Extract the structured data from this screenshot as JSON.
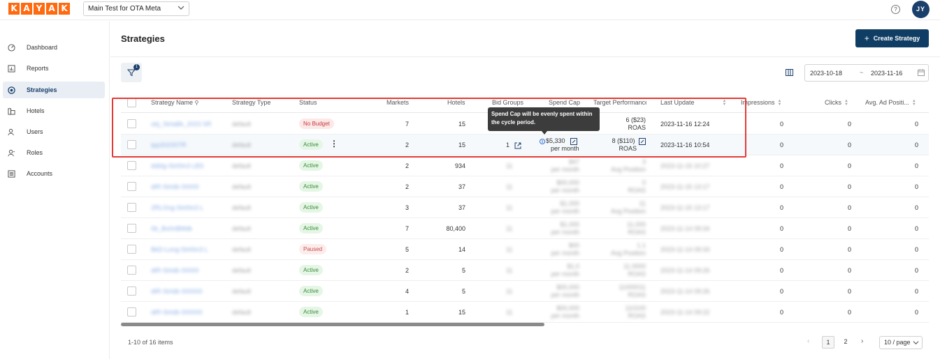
{
  "brand": {
    "letters": [
      "K",
      "A",
      "Y",
      "A",
      "K"
    ],
    "color": "#ff690f"
  },
  "topbar": {
    "account": "Main Test for OTA Meta",
    "help": "?",
    "avatar": "JY"
  },
  "sidebar": {
    "items": [
      {
        "label": "Dashboard",
        "icon": "dashboard-icon"
      },
      {
        "label": "Reports",
        "icon": "reports-icon"
      },
      {
        "label": "Strategies",
        "icon": "strategies-icon",
        "active": true
      },
      {
        "label": "Hotels",
        "icon": "hotels-icon"
      },
      {
        "label": "Users",
        "icon": "users-icon"
      },
      {
        "label": "Roles",
        "icon": "roles-icon"
      },
      {
        "label": "Accounts",
        "icon": "accounts-icon"
      }
    ]
  },
  "header": {
    "title": "Strategies",
    "create_label": "Create Strategy",
    "create_plus": "+"
  },
  "filter": {
    "badge": "1"
  },
  "dates": {
    "start": "2023-10-18",
    "sep": "~",
    "end": "2023-11-16"
  },
  "columns": {
    "name": "Strategy Name",
    "type": "Strategy Type",
    "status": "Status",
    "markets": "Markets",
    "hotels": "Hotels",
    "bid_groups": "Bid Groups",
    "spend_cap": "Spend Cap",
    "target": "Target Performance",
    "last_update": "Last Update",
    "impressions": "Impressions",
    "clicks": "Clicks",
    "avg_pos": "Avg. Ad Positi..."
  },
  "rows": [
    {
      "name": "obj_StrtaBk_2023 SR",
      "type": "default",
      "status": "No Budget",
      "markets": "7",
      "hotels": "15",
      "target_top": "6 ($23)",
      "target_bottom": "ROAS",
      "last_update": "2023-11-16 12:24",
      "impressions": "0",
      "clicks": "0",
      "avg_pos": "0"
    },
    {
      "name": "tpp2023STR",
      "type": "default",
      "status": "Active",
      "markets": "2",
      "hotels": "15",
      "bid_groups": "1",
      "spend_top": "$5,330",
      "spend_bottom": "per month",
      "target_top": "8 ($110)",
      "target_bottom": "ROAS",
      "last_update": "2023-11-16 10:54",
      "impressions": "0",
      "clicks": "0",
      "avg_pos": "0"
    },
    {
      "name": "ddblg-Strt0in3 LBS",
      "type": "default",
      "status": "Active",
      "markets": "2",
      "hotels": "934",
      "bid_groups": "11",
      "spend_top": "$47",
      "spend_bottom": "per month",
      "target_top": "3",
      "target_bottom": "Avg Position",
      "last_update": "2023-11-15 10:27",
      "impressions": "0",
      "clicks": "0",
      "avg_pos": "0"
    },
    {
      "name": "dtR-Strtdb 00000",
      "type": "default",
      "status": "Active",
      "markets": "2",
      "hotels": "37",
      "bid_groups": "11",
      "spend_top": "$00,000",
      "spend_bottom": "per month",
      "target_top": "0",
      "target_bottom": "ROAS",
      "last_update": "2023-11-15 13:17",
      "impressions": "0",
      "clicks": "0",
      "avg_pos": "0"
    },
    {
      "name": "2RLOng-Strt0in3 L",
      "type": "default",
      "status": "Active",
      "markets": "3",
      "hotels": "37",
      "bid_groups": "11",
      "spend_top": "$1,000",
      "spend_bottom": "per month",
      "target_top": "11",
      "target_bottom": "Avg Position",
      "last_update": "2023-11-15 13:17",
      "impressions": "0",
      "clicks": "0",
      "avg_pos": "0"
    },
    {
      "name": "0b_Bo0nBMdk",
      "type": "default",
      "status": "Active",
      "markets": "7",
      "hotels": "80,400",
      "bid_groups": "11",
      "spend_top": "$1,000",
      "spend_bottom": "per month",
      "target_top": "11,000",
      "target_bottom": "ROAS",
      "last_update": "2023-11-14 09:34",
      "impressions": "0",
      "clicks": "0",
      "avg_pos": "0"
    },
    {
      "name": "BkD-Long-Strt0in3 L",
      "type": "default",
      "status": "Paused",
      "markets": "5",
      "hotels": "14",
      "bid_groups": "11",
      "spend_top": "$00",
      "spend_bottom": "per month",
      "target_top": "1.1",
      "target_bottom": "Avg Position",
      "last_update": "2023-11-14 09:33",
      "impressions": "0",
      "clicks": "0",
      "avg_pos": "0"
    },
    {
      "name": "dtR-Strtdb 00000",
      "type": "default",
      "status": "Active",
      "markets": "2",
      "hotels": "5",
      "bid_groups": "11",
      "spend_top": "$1,0",
      "spend_bottom": "per month",
      "target_top": "11.0000",
      "target_bottom": "ROAS",
      "last_update": "2023-11-14 09:26",
      "impressions": "0",
      "clicks": "0",
      "avg_pos": "0"
    },
    {
      "name": "dtR-Strtdb 000000",
      "type": "default",
      "status": "Active",
      "markets": "4",
      "hotels": "5",
      "bid_groups": "11",
      "spend_top": "$00,000",
      "spend_bottom": "per month",
      "target_top": "11000011",
      "target_bottom": "ROAS",
      "last_update": "2023-11-14 09:26",
      "impressions": "0",
      "clicks": "0",
      "avg_pos": "0"
    },
    {
      "name": "dtR-Strtdb 000000",
      "type": "default",
      "status": "Active",
      "markets": "1",
      "hotels": "15",
      "bid_groups": "11",
      "spend_top": "$00,000",
      "spend_bottom": "per month",
      "target_top": "110100",
      "target_bottom": "ROAS",
      "last_update": "2023-11-14 09:22",
      "impressions": "0",
      "clicks": "0",
      "avg_pos": "0"
    }
  ],
  "tooltip": {
    "text": "Spend Cap will be evenly spent within the cycle period."
  },
  "footer": {
    "count": "1-10 of 16 items",
    "prev": "‹",
    "pages": [
      "1",
      "2"
    ],
    "next": "›",
    "page_size": "10 / page"
  },
  "colors": {
    "primary": "#0f3d63",
    "highlight": "#e53935"
  }
}
